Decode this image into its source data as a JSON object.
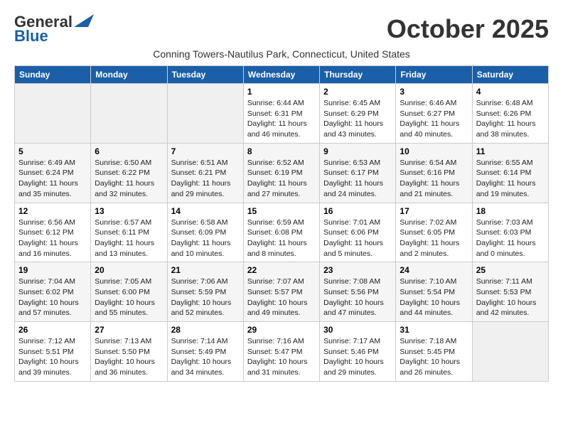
{
  "header": {
    "logo_line1": "General",
    "logo_line2": "Blue",
    "month": "October 2025",
    "location": "Conning Towers-Nautilus Park, Connecticut, United States"
  },
  "weekdays": [
    "Sunday",
    "Monday",
    "Tuesday",
    "Wednesday",
    "Thursday",
    "Friday",
    "Saturday"
  ],
  "weeks": [
    [
      {
        "day": "",
        "info": ""
      },
      {
        "day": "",
        "info": ""
      },
      {
        "day": "",
        "info": ""
      },
      {
        "day": "1",
        "info": "Sunrise: 6:44 AM\nSunset: 6:31 PM\nDaylight: 11 hours\nand 46 minutes."
      },
      {
        "day": "2",
        "info": "Sunrise: 6:45 AM\nSunset: 6:29 PM\nDaylight: 11 hours\nand 43 minutes."
      },
      {
        "day": "3",
        "info": "Sunrise: 6:46 AM\nSunset: 6:27 PM\nDaylight: 11 hours\nand 40 minutes."
      },
      {
        "day": "4",
        "info": "Sunrise: 6:48 AM\nSunset: 6:26 PM\nDaylight: 11 hours\nand 38 minutes."
      }
    ],
    [
      {
        "day": "5",
        "info": "Sunrise: 6:49 AM\nSunset: 6:24 PM\nDaylight: 11 hours\nand 35 minutes."
      },
      {
        "day": "6",
        "info": "Sunrise: 6:50 AM\nSunset: 6:22 PM\nDaylight: 11 hours\nand 32 minutes."
      },
      {
        "day": "7",
        "info": "Sunrise: 6:51 AM\nSunset: 6:21 PM\nDaylight: 11 hours\nand 29 minutes."
      },
      {
        "day": "8",
        "info": "Sunrise: 6:52 AM\nSunset: 6:19 PM\nDaylight: 11 hours\nand 27 minutes."
      },
      {
        "day": "9",
        "info": "Sunrise: 6:53 AM\nSunset: 6:17 PM\nDaylight: 11 hours\nand 24 minutes."
      },
      {
        "day": "10",
        "info": "Sunrise: 6:54 AM\nSunset: 6:16 PM\nDaylight: 11 hours\nand 21 minutes."
      },
      {
        "day": "11",
        "info": "Sunrise: 6:55 AM\nSunset: 6:14 PM\nDaylight: 11 hours\nand 19 minutes."
      }
    ],
    [
      {
        "day": "12",
        "info": "Sunrise: 6:56 AM\nSunset: 6:12 PM\nDaylight: 11 hours\nand 16 minutes."
      },
      {
        "day": "13",
        "info": "Sunrise: 6:57 AM\nSunset: 6:11 PM\nDaylight: 11 hours\nand 13 minutes."
      },
      {
        "day": "14",
        "info": "Sunrise: 6:58 AM\nSunset: 6:09 PM\nDaylight: 11 hours\nand 10 minutes."
      },
      {
        "day": "15",
        "info": "Sunrise: 6:59 AM\nSunset: 6:08 PM\nDaylight: 11 hours\nand 8 minutes."
      },
      {
        "day": "16",
        "info": "Sunrise: 7:01 AM\nSunset: 6:06 PM\nDaylight: 11 hours\nand 5 minutes."
      },
      {
        "day": "17",
        "info": "Sunrise: 7:02 AM\nSunset: 6:05 PM\nDaylight: 11 hours\nand 2 minutes."
      },
      {
        "day": "18",
        "info": "Sunrise: 7:03 AM\nSunset: 6:03 PM\nDaylight: 11 hours\nand 0 minutes."
      }
    ],
    [
      {
        "day": "19",
        "info": "Sunrise: 7:04 AM\nSunset: 6:02 PM\nDaylight: 10 hours\nand 57 minutes."
      },
      {
        "day": "20",
        "info": "Sunrise: 7:05 AM\nSunset: 6:00 PM\nDaylight: 10 hours\nand 55 minutes."
      },
      {
        "day": "21",
        "info": "Sunrise: 7:06 AM\nSunset: 5:59 PM\nDaylight: 10 hours\nand 52 minutes."
      },
      {
        "day": "22",
        "info": "Sunrise: 7:07 AM\nSunset: 5:57 PM\nDaylight: 10 hours\nand 49 minutes."
      },
      {
        "day": "23",
        "info": "Sunrise: 7:08 AM\nSunset: 5:56 PM\nDaylight: 10 hours\nand 47 minutes."
      },
      {
        "day": "24",
        "info": "Sunrise: 7:10 AM\nSunset: 5:54 PM\nDaylight: 10 hours\nand 44 minutes."
      },
      {
        "day": "25",
        "info": "Sunrise: 7:11 AM\nSunset: 5:53 PM\nDaylight: 10 hours\nand 42 minutes."
      }
    ],
    [
      {
        "day": "26",
        "info": "Sunrise: 7:12 AM\nSunset: 5:51 PM\nDaylight: 10 hours\nand 39 minutes."
      },
      {
        "day": "27",
        "info": "Sunrise: 7:13 AM\nSunset: 5:50 PM\nDaylight: 10 hours\nand 36 minutes."
      },
      {
        "day": "28",
        "info": "Sunrise: 7:14 AM\nSunset: 5:49 PM\nDaylight: 10 hours\nand 34 minutes."
      },
      {
        "day": "29",
        "info": "Sunrise: 7:16 AM\nSunset: 5:47 PM\nDaylight: 10 hours\nand 31 minutes."
      },
      {
        "day": "30",
        "info": "Sunrise: 7:17 AM\nSunset: 5:46 PM\nDaylight: 10 hours\nand 29 minutes."
      },
      {
        "day": "31",
        "info": "Sunrise: 7:18 AM\nSunset: 5:45 PM\nDaylight: 10 hours\nand 26 minutes."
      },
      {
        "day": "",
        "info": ""
      }
    ]
  ]
}
